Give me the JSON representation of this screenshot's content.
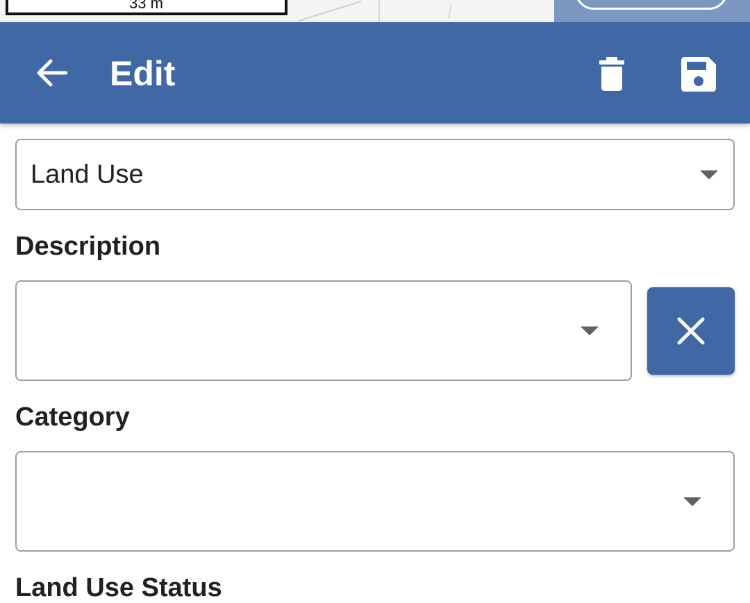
{
  "map": {
    "scale_label": "33 m"
  },
  "appbar": {
    "title": "Edit",
    "back_icon": "arrow-left-icon",
    "delete_icon": "trash-icon",
    "save_icon": "floppy-disk-icon",
    "background": "#3f68a5"
  },
  "form": {
    "type_select": {
      "value": "Land Use"
    },
    "description": {
      "label": "Description",
      "value": ""
    },
    "category": {
      "label": "Category",
      "value": ""
    },
    "land_use_status": {
      "label": "Land Use Status"
    }
  },
  "colors": {
    "accent": "#3f68a5",
    "border": "#9e9e9e",
    "text": "#212121"
  }
}
